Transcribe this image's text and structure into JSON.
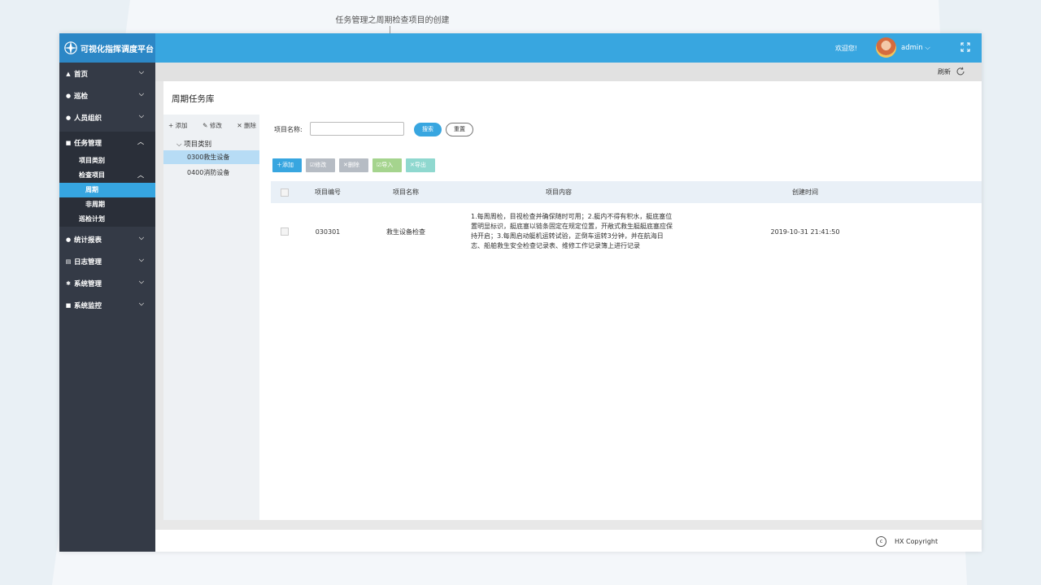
{
  "caption": "任务管理之周期检查项目的创建",
  "app": {
    "title": "可视化指挥调度平台",
    "welcome": "欢迎您!",
    "username": "admin"
  },
  "sidebar": {
    "items": [
      {
        "label": "首页",
        "icon": "home-icon"
      },
      {
        "label": "巡检",
        "icon": "user-icon"
      },
      {
        "label": "人员组织",
        "icon": "user-icon"
      },
      {
        "label": "任务管理",
        "icon": "grid-icon"
      },
      {
        "label": "统计报表",
        "icon": "user-icon"
      },
      {
        "label": "日志管理",
        "icon": "doc-icon"
      },
      {
        "label": "系统管理",
        "icon": "gear-icon"
      },
      {
        "label": "系统监控",
        "icon": "camera-icon"
      }
    ],
    "task_sub": [
      "项目类别",
      "检查项目",
      "巡检计划"
    ],
    "check_sub": [
      "周期",
      "非周期"
    ]
  },
  "graybar": {
    "refresh": "刷新"
  },
  "panel": {
    "title": "周期任务库"
  },
  "tree": {
    "actions": {
      "add": "+ 添加",
      "edit": "修改",
      "delete": "删除"
    },
    "root": "项目类别",
    "nodes": [
      "0300救生设备",
      "0400消防设备"
    ]
  },
  "search": {
    "label": "项目名称:",
    "value": "",
    "search_btn": "搜索",
    "reset_btn": "重置"
  },
  "toolbar": {
    "add": "添加",
    "edit": "修改",
    "delete": "删除",
    "import": "导入",
    "export": "导出"
  },
  "table": {
    "headers": {
      "code": "项目编号",
      "name": "项目名称",
      "content": "项目内容",
      "time": "创建时间"
    },
    "rows": [
      {
        "code": "030301",
        "name": "救生设备检查",
        "content": "1.每周周检，目视检查并确保随时可用；2.艇内不得有积水，艇底塞位置明显标识，艇底塞以链条固定在规定位置，开敞式救生艇艇底塞应保持开启；3.每周启动艇机运转试验，正倒车运转3分钟，并在航海日志、船舶救生安全检查记录表、维修工作记录簿上进行记录",
        "time": "2019-10-31  21:41:50"
      }
    ]
  },
  "footer": {
    "copyright": "HX Copyright",
    "icon": "c"
  }
}
